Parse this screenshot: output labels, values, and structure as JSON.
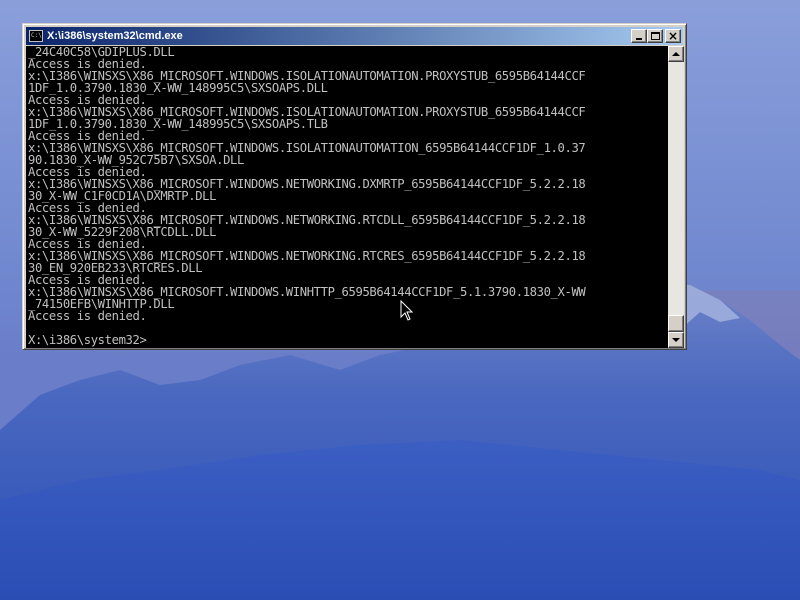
{
  "window": {
    "title": "X:\\i386\\system32\\cmd.exe",
    "icon_text": "C:\\"
  },
  "console": {
    "lines": [
      "_24C40C58\\GDIPLUS.DLL",
      "Access is denied.",
      "x:\\I386\\WINSXS\\X86_MICROSOFT.WINDOWS.ISOLATIONAUTOMATION.PROXYSTUB_6595B64144CCF",
      "1DF_1.0.3790.1830_X-WW_148995C5\\SXSOAPS.DLL",
      "Access is denied.",
      "x:\\I386\\WINSXS\\X86_MICROSOFT.WINDOWS.ISOLATIONAUTOMATION.PROXYSTUB_6595B64144CCF",
      "1DF_1.0.3790.1830_X-WW_148995C5\\SXSOAPS.TLB",
      "Access is denied.",
      "x:\\I386\\WINSXS\\X86_MICROSOFT.WINDOWS.ISOLATIONAUTOMATION_6595B64144CCF1DF_1.0.37",
      "90.1830_X-WW_952C75B7\\SXSOA.DLL",
      "Access is denied.",
      "x:\\I386\\WINSXS\\X86_MICROSOFT.WINDOWS.NETWORKING.DXMRTP_6595B64144CCF1DF_5.2.2.18",
      "30_X-WW_C1F0CD1A\\DXMRTP.DLL",
      "Access is denied.",
      "x:\\I386\\WINSXS\\X86_MICROSOFT.WINDOWS.NETWORKING.RTCDLL_6595B64144CCF1DF_5.2.2.18",
      "30_X-WW_5229F208\\RTCDLL.DLL",
      "Access is denied.",
      "x:\\I386\\WINSXS\\X86_MICROSOFT.WINDOWS.NETWORKING.RTCRES_6595B64144CCF1DF_5.2.2.18",
      "30_EN_920EB233\\RTCRES.DLL",
      "Access is denied.",
      "x:\\I386\\WINSXS\\X86_MICROSOFT.WINDOWS.WINHTTP_6595B64144CCF1DF_5.1.3790.1830_X-WW",
      "_74150EFB\\WINHTTP.DLL",
      "Access is denied.",
      "",
      "X:\\i386\\system32>"
    ]
  },
  "colors": {
    "console_bg": "#000000",
    "console_fg": "#c0c0c0",
    "titlebar_start": "#0a246a",
    "titlebar_end": "#a6caf0"
  }
}
